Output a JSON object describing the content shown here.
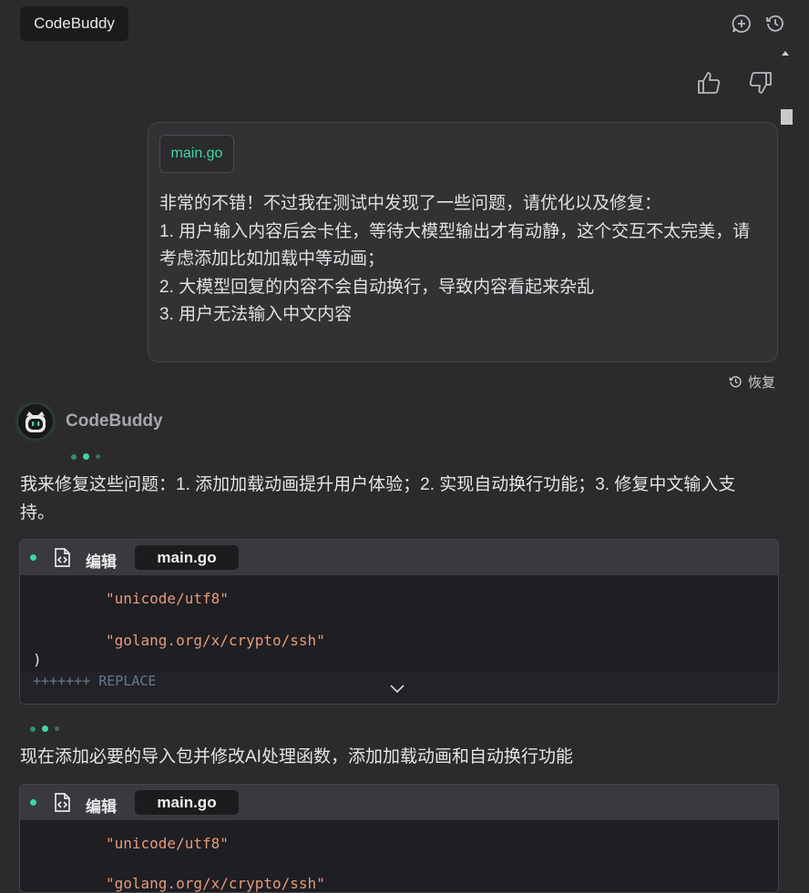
{
  "header": {
    "app_tab": "CodeBuddy",
    "icons": [
      "add-chat-icon",
      "history-icon"
    ]
  },
  "feedback": {
    "icons": [
      "thumbs-up-icon",
      "thumbs-down-icon"
    ]
  },
  "user_message": {
    "file_chip": "main.go",
    "lines": [
      "非常的不错！不过我在测试中发现了一些问题，请优化以及修复：",
      "1. 用户输入内容后会卡住，等待大模型输出才有动静，这个交互不太完美，请",
      "考虑添加比如加载中等动画；",
      "2. 大模型回复的内容不会自动换行，导致内容看起来杂乱",
      "3. 用户无法输入中文内容"
    ],
    "restore_label": "恢复"
  },
  "assistant": {
    "name": "CodeBuddy",
    "text1_line1": "我来修复这些问题：1. 添加加载动画提升用户体验；2. 实现自动换行功能；3. 修复中文输入支",
    "text1_line2": "持。",
    "text2": "现在添加必要的导入包并修改AI处理函数，添加加载动画和自动换行功能",
    "edit_blocks": [
      {
        "label": "编辑",
        "file": "main.go",
        "code": [
          "\"unicode/utf8\"",
          "\"golang.org/x/crypto/ssh\"",
          ")",
          "+++++++ REPLACE"
        ]
      },
      {
        "label": "编辑",
        "file": "main.go",
        "code": [
          "\"unicode/utf8\"",
          "\"golang.org/x/crypto/ssh\""
        ]
      }
    ]
  },
  "colors": {
    "accent": "#3fd6a4",
    "background": "#2b2b2d",
    "string": "#e39b7b"
  }
}
